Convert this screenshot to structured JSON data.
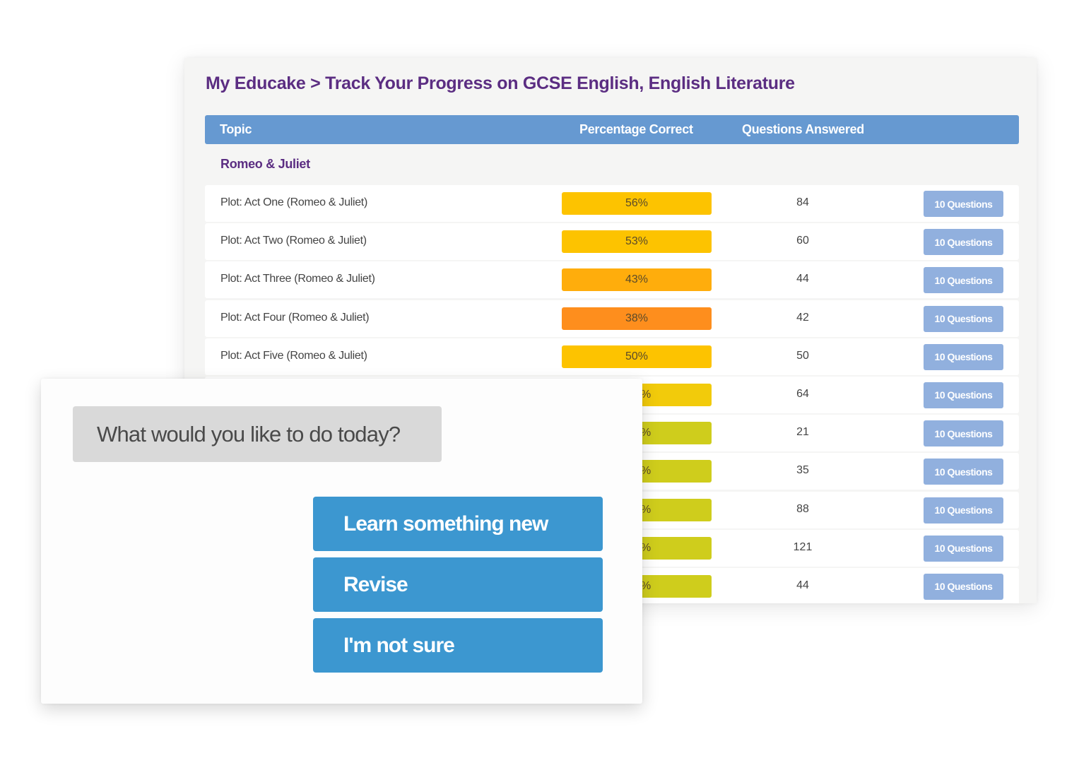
{
  "tracker": {
    "breadcrumb": "My Educake > Track Your Progress on GCSE English, English Literature",
    "columns": {
      "topic": "Topic",
      "percentage": "Percentage Correct",
      "answered": "Questions Answered"
    },
    "group_title": "Romeo & Juliet",
    "rows": [
      {
        "topic": "Plot: Act One (Romeo & Juliet)",
        "percent": "56%",
        "answered": "84",
        "button": "10 Questions",
        "bar_color": "#fdc300"
      },
      {
        "topic": "Plot: Act Two (Romeo & Juliet)",
        "percent": "53%",
        "answered": "60",
        "button": "10 Questions",
        "bar_color": "#fdc300"
      },
      {
        "topic": "Plot: Act Three (Romeo & Juliet)",
        "percent": "43%",
        "answered": "44",
        "button": "10 Questions",
        "bar_color": "#ffad0c"
      },
      {
        "topic": "Plot: Act Four (Romeo & Juliet)",
        "percent": "38%",
        "answered": "42",
        "button": "10 Questions",
        "bar_color": "#fe8e1d"
      },
      {
        "topic": "Plot: Act Five (Romeo & Juliet)",
        "percent": "50%",
        "answered": "50",
        "button": "10 Questions",
        "bar_color": "#fdc300"
      },
      {
        "topic": "",
        "percent": "%",
        "answered": "64",
        "button": "10 Questions",
        "bar_color": "#f2cb0b"
      },
      {
        "topic": "",
        "percent": "%",
        "answered": "21",
        "button": "10 Questions",
        "bar_color": "#cfcd1c"
      },
      {
        "topic": "",
        "percent": "%",
        "answered": "35",
        "button": "10 Questions",
        "bar_color": "#cfcd1c"
      },
      {
        "topic": "",
        "percent": "%",
        "answered": "88",
        "button": "10 Questions",
        "bar_color": "#cfcd1c"
      },
      {
        "topic": "",
        "percent": "%",
        "answered": "121",
        "button": "10 Questions",
        "bar_color": "#cfcd1c"
      },
      {
        "topic": "",
        "percent": "%",
        "answered": "44",
        "button": "10 Questions",
        "bar_color": "#cfcd1c"
      }
    ]
  },
  "chooser": {
    "prompt": "What would you like to do today?",
    "options": [
      "Learn something new",
      "Revise",
      "I'm not sure"
    ]
  },
  "colors": {
    "brand_purple": "#5b2d82",
    "header_blue": "#6699d1",
    "question_button": "#91b0de",
    "choice_button": "#3c97d0"
  }
}
